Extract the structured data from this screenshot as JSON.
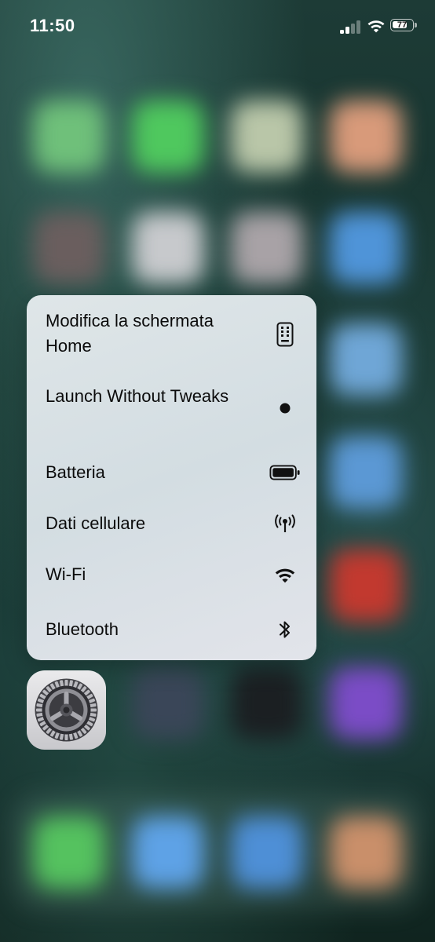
{
  "status_bar": {
    "time": "11:50",
    "battery_level": "77",
    "battery_fraction": 0.77,
    "signal_bars_active": 2,
    "signal_bars_total": 4
  },
  "context_menu": {
    "items": [
      {
        "label": "Modifica la schermata Home",
        "icon": "home-screen-edit-icon"
      },
      {
        "label": "Launch Without Tweaks",
        "icon": "dot-icon"
      },
      {
        "label": "Batteria",
        "icon": "battery-icon"
      },
      {
        "label": "Dati cellulare",
        "icon": "cellular-antenna-icon"
      },
      {
        "label": "Wi-Fi",
        "icon": "wifi-icon"
      },
      {
        "label": "Bluetooth",
        "icon": "bluetooth-icon"
      }
    ]
  },
  "app": {
    "icon": "settings-gear-icon"
  },
  "colors": {
    "menu_background": "#dfe6e8",
    "menu_text": "#0b0b0b",
    "status_text": "#ffffff"
  }
}
